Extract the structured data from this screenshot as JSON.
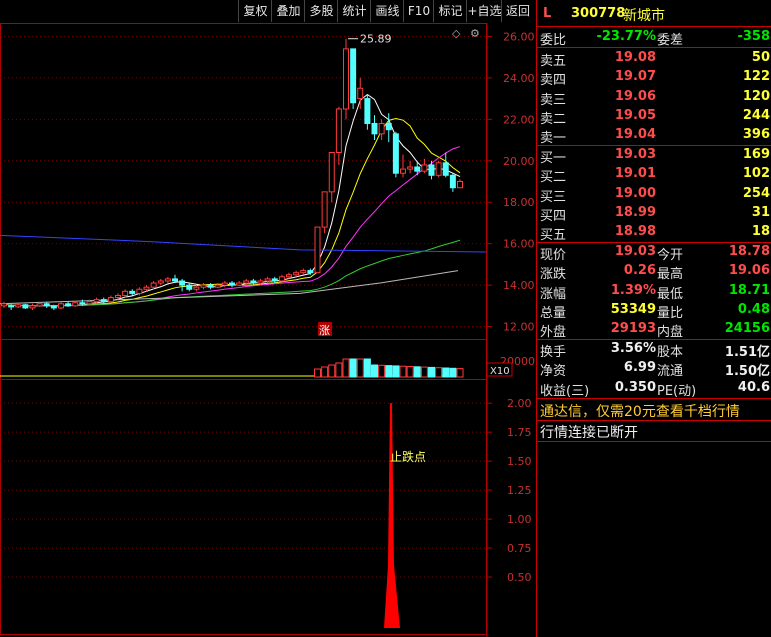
{
  "toolbar": {
    "buttons": [
      "复权",
      "叠加",
      "多股",
      "统计",
      "画线",
      "F10",
      "标记",
      "+自选",
      "返回"
    ]
  },
  "chart_data": [
    {
      "type": "candlestick",
      "panel": "price",
      "ylim": [
        11.4,
        26.6
      ],
      "y_ticks": [
        "26.00",
        "24.00",
        "22.00",
        "20.00",
        "18.00",
        "16.00",
        "14.00",
        "12.00"
      ],
      "high_label": "25.89",
      "marker": "涨",
      "candles": [
        [
          13.0,
          13.1,
          12.9,
          13.2
        ],
        [
          13.0,
          12.95,
          12.8,
          13.1
        ],
        [
          12.95,
          13.05,
          12.9,
          13.15
        ],
        [
          13.05,
          12.9,
          12.85,
          13.1
        ],
        [
          12.9,
          13.0,
          12.8,
          13.1
        ],
        [
          13.0,
          13.1,
          12.95,
          13.2
        ],
        [
          13.1,
          13.0,
          12.9,
          13.2
        ],
        [
          13.0,
          12.9,
          12.8,
          13.05
        ],
        [
          12.9,
          13.1,
          12.85,
          13.2
        ],
        [
          13.1,
          13.0,
          12.95,
          13.2
        ],
        [
          13.0,
          13.15,
          12.95,
          13.25
        ],
        [
          13.15,
          13.1,
          13.0,
          13.3
        ],
        [
          13.1,
          13.2,
          13.05,
          13.3
        ],
        [
          13.2,
          13.3,
          13.1,
          13.4
        ],
        [
          13.3,
          13.2,
          13.1,
          13.4
        ],
        [
          13.2,
          13.4,
          13.15,
          13.5
        ],
        [
          13.4,
          13.5,
          13.3,
          13.6
        ],
        [
          13.5,
          13.7,
          13.4,
          13.8
        ],
        [
          13.7,
          13.6,
          13.5,
          13.8
        ],
        [
          13.6,
          13.8,
          13.5,
          13.9
        ],
        [
          13.8,
          13.9,
          13.7,
          14.0
        ],
        [
          13.9,
          14.1,
          13.8,
          14.2
        ],
        [
          14.1,
          14.2,
          14.0,
          14.3
        ],
        [
          14.2,
          14.3,
          14.1,
          14.4
        ],
        [
          14.3,
          14.2,
          14.1,
          14.5
        ],
        [
          14.2,
          14.0,
          13.7,
          14.3
        ],
        [
          14.0,
          13.8,
          13.7,
          14.1
        ],
        [
          13.8,
          13.9,
          13.7,
          14.0
        ],
        [
          13.9,
          14.0,
          13.8,
          14.1
        ],
        [
          14.0,
          13.9,
          13.8,
          14.1
        ],
        [
          13.9,
          14.0,
          13.85,
          14.1
        ],
        [
          14.0,
          14.1,
          13.9,
          14.2
        ],
        [
          14.1,
          14.0,
          13.9,
          14.2
        ],
        [
          14.0,
          14.1,
          13.95,
          14.2
        ],
        [
          14.1,
          14.2,
          14.0,
          14.3
        ],
        [
          14.2,
          14.1,
          14.0,
          14.3
        ],
        [
          14.1,
          14.2,
          14.0,
          14.3
        ],
        [
          14.2,
          14.3,
          14.1,
          14.4
        ],
        [
          14.3,
          14.2,
          14.1,
          14.4
        ],
        [
          14.2,
          14.4,
          14.1,
          14.5
        ],
        [
          14.4,
          14.5,
          14.3,
          14.6
        ],
        [
          14.5,
          14.6,
          14.4,
          14.7
        ],
        [
          14.6,
          14.7,
          14.5,
          14.8
        ],
        [
          14.7,
          14.6,
          14.5,
          14.8
        ],
        [
          14.6,
          16.8,
          14.6,
          16.8
        ],
        [
          16.8,
          18.5,
          16.5,
          18.5
        ],
        [
          18.5,
          20.4,
          18.0,
          20.4
        ],
        [
          20.4,
          22.5,
          19.8,
          22.6
        ],
        [
          22.5,
          25.4,
          22.0,
          25.89
        ],
        [
          25.4,
          22.8,
          22.5,
          25.4
        ],
        [
          23.0,
          23.5,
          22.5,
          24.0
        ],
        [
          23.0,
          21.8,
          21.5,
          23.2
        ],
        [
          21.8,
          21.3,
          21.0,
          22.2
        ],
        [
          21.3,
          21.8,
          21.0,
          22.0
        ],
        [
          21.8,
          21.5,
          20.9,
          22.3
        ],
        [
          21.3,
          19.4,
          19.2,
          21.4
        ],
        [
          19.4,
          19.6,
          19.2,
          20.3
        ],
        [
          19.6,
          19.7,
          19.4,
          20.0
        ],
        [
          19.7,
          19.5,
          19.3,
          20.0
        ],
        [
          19.5,
          19.8,
          19.4,
          20.1
        ],
        [
          19.8,
          19.3,
          19.1,
          20.0
        ],
        [
          19.3,
          19.9,
          19.2,
          20.0
        ],
        [
          19.9,
          19.3,
          19.2,
          20.4
        ],
        [
          19.3,
          18.7,
          18.5,
          19.4
        ],
        [
          18.7,
          19.0,
          18.7,
          19.1
        ]
      ]
    },
    {
      "type": "bar",
      "panel": "volume",
      "y_tick": "20000",
      "unit": "X10"
    },
    {
      "type": "bar",
      "panel": "indicator",
      "ylim": [
        0,
        2.2
      ],
      "y_ticks": [
        "2.00",
        "1.75",
        "1.50",
        "1.25",
        "1.00",
        "0.75",
        "0.50"
      ],
      "annotation": "止跌点",
      "values": [
        0,
        0,
        0,
        0,
        0,
        0,
        0,
        0,
        0,
        0,
        0,
        0,
        0,
        0,
        0,
        0,
        0,
        0,
        0,
        0,
        0,
        0,
        0,
        0,
        0,
        0,
        0,
        0,
        0,
        0,
        0,
        0,
        0,
        0,
        0,
        0,
        0,
        0,
        0,
        0,
        0,
        0,
        0,
        0,
        0,
        0,
        0,
        0,
        0,
        0,
        0,
        0,
        0,
        0,
        0,
        0,
        0,
        0,
        0,
        0,
        0,
        0,
        0,
        0,
        0,
        0,
        0,
        0,
        0,
        0,
        0,
        0,
        0,
        0,
        0,
        0,
        0,
        0,
        0,
        0,
        0,
        0,
        0,
        0,
        0,
        0,
        0,
        0,
        0,
        0,
        0,
        0,
        0,
        0,
        0,
        0,
        0,
        0,
        0,
        0,
        0,
        0,
        0,
        0,
        0,
        0,
        0,
        0,
        0,
        0,
        0,
        0,
        0,
        0,
        0,
        0,
        0,
        0,
        0,
        0,
        0,
        0,
        0,
        0,
        0,
        0,
        0,
        0,
        0,
        0,
        0,
        0,
        0,
        0,
        0,
        0,
        0,
        0,
        0,
        0,
        0,
        0,
        0,
        0,
        0,
        0,
        0,
        0,
        0,
        0,
        0,
        0,
        0,
        0,
        0,
        0,
        0,
        0,
        0,
        0,
        0,
        0,
        0,
        0,
        0,
        0,
        0,
        0,
        0,
        0,
        0,
        0,
        0,
        0,
        0,
        0,
        0,
        0,
        0,
        0,
        0,
        0,
        0,
        0,
        0,
        0,
        0,
        0,
        0,
        0,
        0,
        0,
        0,
        0,
        0,
        0,
        0,
        0,
        0,
        0,
        0,
        0,
        0,
        0,
        0,
        0,
        0,
        0,
        0,
        0,
        0,
        0,
        0,
        0,
        0,
        0,
        0,
        0,
        0,
        0,
        0,
        0,
        0,
        0,
        0,
        0,
        0,
        0,
        0,
        0,
        0,
        0,
        0,
        0,
        0,
        0,
        0,
        0,
        0,
        0,
        0,
        0,
        0,
        0,
        0,
        0,
        0,
        0,
        0,
        0,
        0,
        0,
        0,
        0,
        0,
        0,
        0,
        0,
        0,
        0,
        0,
        0,
        0,
        0,
        0,
        0,
        0,
        0,
        0,
        0,
        0,
        0,
        0,
        0,
        0,
        0,
        0,
        0,
        0,
        0,
        0,
        0,
        0,
        0,
        0,
        0,
        0,
        0,
        0,
        0,
        0,
        0,
        0,
        0,
        0,
        0,
        0,
        0,
        0,
        0,
        0,
        0,
        0,
        0,
        0,
        0,
        0,
        0,
        0,
        0,
        0,
        0,
        0,
        0,
        0,
        0,
        0,
        0,
        0,
        0,
        0,
        0,
        0,
        0,
        0,
        0,
        0,
        0,
        0,
        0,
        0,
        0,
        0,
        0,
        0,
        0,
        0,
        0,
        0,
        0,
        0,
        0,
        0,
        0,
        0,
        0,
        0,
        0,
        0,
        0,
        0,
        0,
        0,
        0,
        0,
        0,
        0,
        0,
        0,
        0,
        0,
        0,
        0,
        0,
        0,
        0,
        0,
        0,
        0,
        0,
        0,
        0,
        0,
        0,
        0,
        0,
        0,
        0,
        0,
        0,
        0,
        0,
        0,
        0,
        0,
        0,
        0,
        0,
        0,
        0,
        0,
        0,
        0,
        0,
        0,
        0,
        0,
        0,
        0,
        0,
        0,
        0,
        0,
        0,
        0,
        0,
        0,
        0,
        0,
        0,
        0,
        0,
        0,
        0,
        0,
        0,
        0,
        0,
        0,
        0,
        0,
        0,
        0,
        0,
        0,
        0,
        0,
        0,
        0,
        0,
        0,
        0,
        0,
        0,
        0,
        0,
        0,
        0,
        0,
        0,
        0,
        0,
        0,
        0,
        0,
        0,
        0,
        0,
        0,
        0,
        0,
        0,
        0,
        0,
        0,
        0,
        0,
        0,
        0,
        0,
        0,
        0,
        0,
        0,
        0,
        0,
        0,
        0,
        0,
        0,
        0,
        0,
        0,
        0,
        0,
        0,
        0,
        0,
        0,
        0,
        0,
        0,
        0,
        0,
        0,
        0,
        0,
        0,
        0,
        0,
        0,
        0,
        0,
        0,
        0,
        0,
        0,
        0,
        0,
        0,
        0,
        0,
        0,
        0,
        0,
        0,
        0,
        0,
        0,
        0,
        0,
        0,
        0,
        0,
        0,
        0,
        0,
        0,
        0,
        0,
        0,
        0,
        0,
        0,
        0,
        0,
        0,
        0,
        0,
        0,
        0,
        0,
        0,
        0,
        0,
        0,
        0,
        0,
        0,
        0
      ]
    }
  ],
  "quote": {
    "flag": "L",
    "code": "300778",
    "name": "新城市",
    "weibi_label": "委比",
    "weibi_value": "-23.77%",
    "weicha_label": "委差",
    "weicha_value": "-358",
    "asks": [
      {
        "label": "卖五",
        "price": "19.08",
        "vol": "50"
      },
      {
        "label": "卖四",
        "price": "19.07",
        "vol": "122"
      },
      {
        "label": "卖三",
        "price": "19.06",
        "vol": "120"
      },
      {
        "label": "卖二",
        "price": "19.05",
        "vol": "244"
      },
      {
        "label": "卖一",
        "price": "19.04",
        "vol": "396"
      }
    ],
    "bids": [
      {
        "label": "买一",
        "price": "19.03",
        "vol": "169"
      },
      {
        "label": "买二",
        "price": "19.01",
        "vol": "102"
      },
      {
        "label": "买三",
        "price": "19.00",
        "vol": "254"
      },
      {
        "label": "买四",
        "price": "18.99",
        "vol": "31"
      },
      {
        "label": "买五",
        "price": "18.98",
        "vol": "18"
      }
    ],
    "stats": [
      {
        "l1": "现价",
        "v1": "19.03",
        "c1": "red",
        "l2": "今开",
        "v2": "18.78",
        "c2": "red"
      },
      {
        "l1": "涨跌",
        "v1": "0.26",
        "c1": "red",
        "l2": "最高",
        "v2": "19.06",
        "c2": "red"
      },
      {
        "l1": "涨幅",
        "v1": "1.39%",
        "c1": "red",
        "l2": "最低",
        "v2": "18.71",
        "c2": "green"
      },
      {
        "l1": "总量",
        "v1": "53349",
        "c1": "yellow",
        "l2": "量比",
        "v2": "0.48",
        "c2": "green"
      },
      {
        "l1": "外盘",
        "v1": "29193",
        "c1": "red",
        "l2": "内盘",
        "v2": "24156",
        "c2": "green"
      }
    ],
    "stats2": [
      {
        "l1": "换手",
        "v1": "3.56%",
        "c1": "white",
        "l2": "股本",
        "v2": "1.51亿",
        "c2": "white"
      },
      {
        "l1": "净资",
        "v1": "6.99",
        "c1": "white",
        "l2": "流通",
        "v2": "1.50亿",
        "c2": "white"
      },
      {
        "l1": "收益(三)",
        "v1": "0.350",
        "c1": "white",
        "l2": "PE(动)",
        "v2": "40.6",
        "c2": "white"
      }
    ],
    "promo": "通达信，仅需20元查看千档行情",
    "status": "行情连接已断开"
  }
}
